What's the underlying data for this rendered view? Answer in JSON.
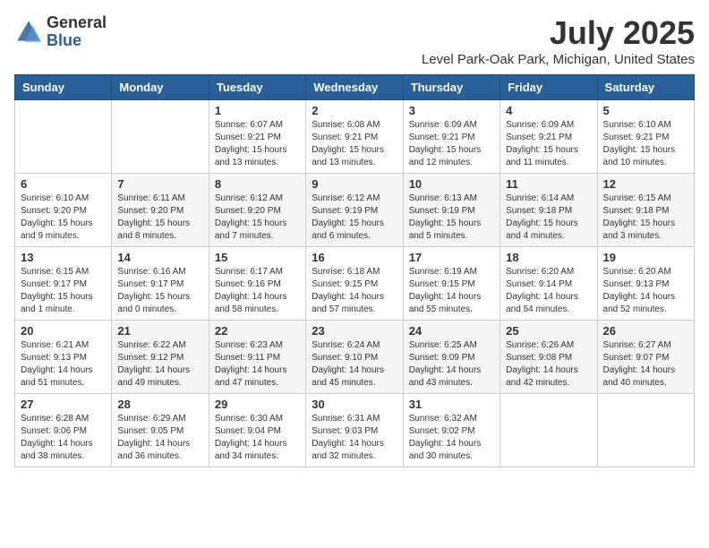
{
  "header": {
    "logo_general": "General",
    "logo_blue": "Blue",
    "month_year": "July 2025",
    "location": "Level Park-Oak Park, Michigan, United States"
  },
  "weekdays": [
    "Sunday",
    "Monday",
    "Tuesday",
    "Wednesday",
    "Thursday",
    "Friday",
    "Saturday"
  ],
  "weeks": [
    [
      {
        "day": "",
        "info": ""
      },
      {
        "day": "",
        "info": ""
      },
      {
        "day": "1",
        "info": "Sunrise: 6:07 AM\nSunset: 9:21 PM\nDaylight: 15 hours and 13 minutes."
      },
      {
        "day": "2",
        "info": "Sunrise: 6:08 AM\nSunset: 9:21 PM\nDaylight: 15 hours and 13 minutes."
      },
      {
        "day": "3",
        "info": "Sunrise: 6:09 AM\nSunset: 9:21 PM\nDaylight: 15 hours and 12 minutes."
      },
      {
        "day": "4",
        "info": "Sunrise: 6:09 AM\nSunset: 9:21 PM\nDaylight: 15 hours and 11 minutes."
      },
      {
        "day": "5",
        "info": "Sunrise: 6:10 AM\nSunset: 9:21 PM\nDaylight: 15 hours and 10 minutes."
      }
    ],
    [
      {
        "day": "6",
        "info": "Sunrise: 6:10 AM\nSunset: 9:20 PM\nDaylight: 15 hours and 9 minutes."
      },
      {
        "day": "7",
        "info": "Sunrise: 6:11 AM\nSunset: 9:20 PM\nDaylight: 15 hours and 8 minutes."
      },
      {
        "day": "8",
        "info": "Sunrise: 6:12 AM\nSunset: 9:20 PM\nDaylight: 15 hours and 7 minutes."
      },
      {
        "day": "9",
        "info": "Sunrise: 6:12 AM\nSunset: 9:19 PM\nDaylight: 15 hours and 6 minutes."
      },
      {
        "day": "10",
        "info": "Sunrise: 6:13 AM\nSunset: 9:19 PM\nDaylight: 15 hours and 5 minutes."
      },
      {
        "day": "11",
        "info": "Sunrise: 6:14 AM\nSunset: 9:18 PM\nDaylight: 15 hours and 4 minutes."
      },
      {
        "day": "12",
        "info": "Sunrise: 6:15 AM\nSunset: 9:18 PM\nDaylight: 15 hours and 3 minutes."
      }
    ],
    [
      {
        "day": "13",
        "info": "Sunrise: 6:15 AM\nSunset: 9:17 PM\nDaylight: 15 hours and 1 minute."
      },
      {
        "day": "14",
        "info": "Sunrise: 6:16 AM\nSunset: 9:17 PM\nDaylight: 15 hours and 0 minutes."
      },
      {
        "day": "15",
        "info": "Sunrise: 6:17 AM\nSunset: 9:16 PM\nDaylight: 14 hours and 58 minutes."
      },
      {
        "day": "16",
        "info": "Sunrise: 6:18 AM\nSunset: 9:15 PM\nDaylight: 14 hours and 57 minutes."
      },
      {
        "day": "17",
        "info": "Sunrise: 6:19 AM\nSunset: 9:15 PM\nDaylight: 14 hours and 55 minutes."
      },
      {
        "day": "18",
        "info": "Sunrise: 6:20 AM\nSunset: 9:14 PM\nDaylight: 14 hours and 54 minutes."
      },
      {
        "day": "19",
        "info": "Sunrise: 6:20 AM\nSunset: 9:13 PM\nDaylight: 14 hours and 52 minutes."
      }
    ],
    [
      {
        "day": "20",
        "info": "Sunrise: 6:21 AM\nSunset: 9:13 PM\nDaylight: 14 hours and 51 minutes."
      },
      {
        "day": "21",
        "info": "Sunrise: 6:22 AM\nSunset: 9:12 PM\nDaylight: 14 hours and 49 minutes."
      },
      {
        "day": "22",
        "info": "Sunrise: 6:23 AM\nSunset: 9:11 PM\nDaylight: 14 hours and 47 minutes."
      },
      {
        "day": "23",
        "info": "Sunrise: 6:24 AM\nSunset: 9:10 PM\nDaylight: 14 hours and 45 minutes."
      },
      {
        "day": "24",
        "info": "Sunrise: 6:25 AM\nSunset: 9:09 PM\nDaylight: 14 hours and 43 minutes."
      },
      {
        "day": "25",
        "info": "Sunrise: 6:26 AM\nSunset: 9:08 PM\nDaylight: 14 hours and 42 minutes."
      },
      {
        "day": "26",
        "info": "Sunrise: 6:27 AM\nSunset: 9:07 PM\nDaylight: 14 hours and 40 minutes."
      }
    ],
    [
      {
        "day": "27",
        "info": "Sunrise: 6:28 AM\nSunset: 9:06 PM\nDaylight: 14 hours and 38 minutes."
      },
      {
        "day": "28",
        "info": "Sunrise: 6:29 AM\nSunset: 9:05 PM\nDaylight: 14 hours and 36 minutes."
      },
      {
        "day": "29",
        "info": "Sunrise: 6:30 AM\nSunset: 9:04 PM\nDaylight: 14 hours and 34 minutes."
      },
      {
        "day": "30",
        "info": "Sunrise: 6:31 AM\nSunset: 9:03 PM\nDaylight: 14 hours and 32 minutes."
      },
      {
        "day": "31",
        "info": "Sunrise: 6:32 AM\nSunset: 9:02 PM\nDaylight: 14 hours and 30 minutes."
      },
      {
        "day": "",
        "info": ""
      },
      {
        "day": "",
        "info": ""
      }
    ]
  ]
}
